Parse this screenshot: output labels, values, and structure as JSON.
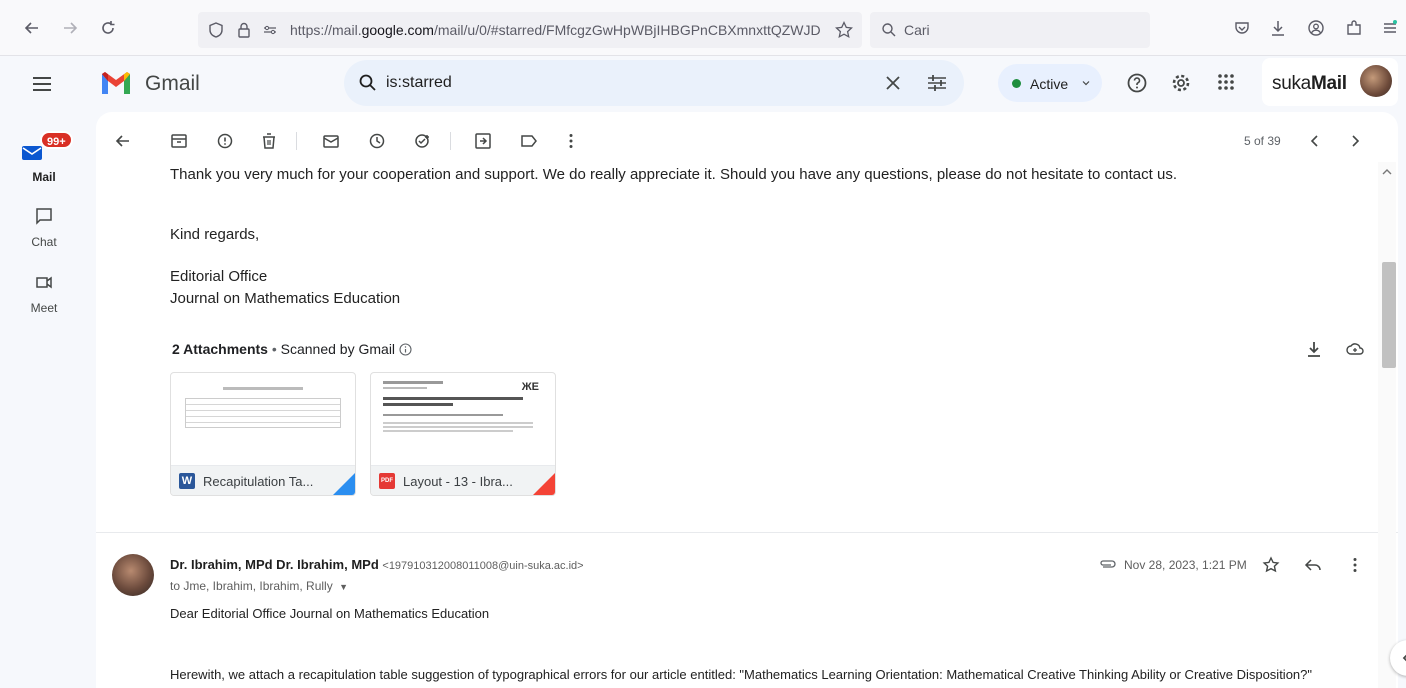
{
  "browser": {
    "url_prefix": "https://mail.",
    "url_domain": "google.com",
    "url_rest": "/mail/u/0/#starred/FMfcgzGwHpWBjIHBGPnCBXmnxttQZWJD",
    "search_placeholder": "Cari"
  },
  "gmail": {
    "brand": "Gmail",
    "search_query": "is:starred",
    "status": "Active",
    "org_name_a": "suka",
    "org_name_b": "Mail"
  },
  "rail": {
    "mail_badge": "99+",
    "items": [
      {
        "label": "Mail",
        "icon": "mail-icon"
      },
      {
        "label": "Chat",
        "icon": "chat-icon"
      },
      {
        "label": "Meet",
        "icon": "meet-icon"
      }
    ]
  },
  "toolbar": {
    "pager": "5 of 39"
  },
  "message1": {
    "line1": "Thank you very much for your cooperation and support. We do really appreciate it. Should you have any questions, please do not hesitate to contact us.",
    "closing": "Kind regards,",
    "sig1": "Editorial Office",
    "sig2": "Journal on Mathematics Education",
    "attachments_count": "2 Attachments",
    "scanned": "Scanned by Gmail",
    "attachments": [
      {
        "name": "Recapitulation Ta...",
        "type": "W",
        "color": "#2b579a"
      },
      {
        "name": "Layout - 13 - Ibra...",
        "type": "PDF",
        "color": "#e53935"
      }
    ]
  },
  "message2": {
    "sender": "Dr. Ibrahim, MPd Dr. Ibrahim, MPd",
    "email": "<197910312008011008@uin-suka.ac.id>",
    "recipients": "to Jme, Ibrahim, Ibrahim, Rully",
    "date": "Nov 28, 2023, 1:21 PM",
    "greeting": "Dear Editorial Office Journal on Mathematics Education",
    "body": "Herewith, we attach a recapitulation table suggestion of typographical errors for our article entitled: \"Mathematics Learning Orientation: Mathematical Creative Thinking Ability or Creative Disposition?\""
  }
}
